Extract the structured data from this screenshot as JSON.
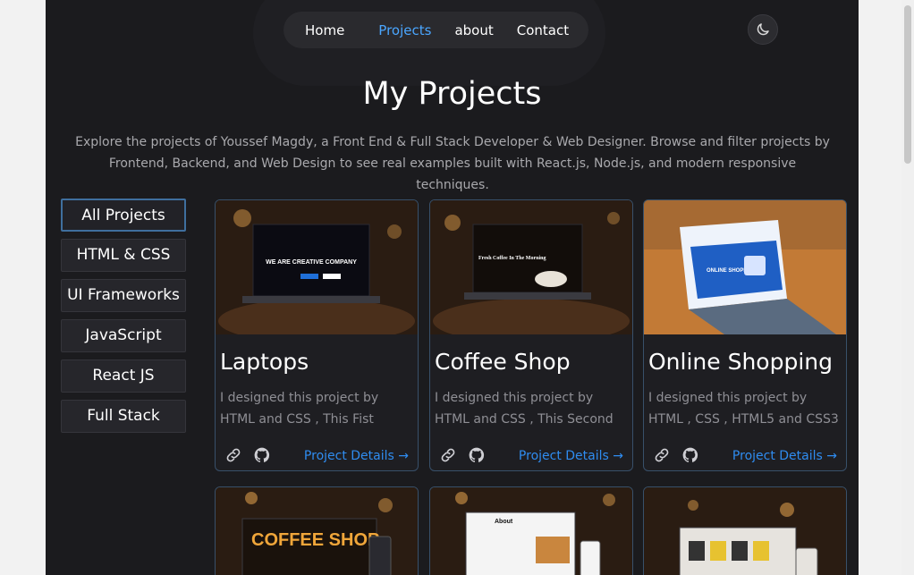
{
  "nav": {
    "items": [
      {
        "label": "Home"
      },
      {
        "label": "Projects"
      },
      {
        "label": "about"
      },
      {
        "label": "Contact"
      }
    ],
    "active_color": "#4aa6ff"
  },
  "theme_toggle": {
    "icon": "moon-icon"
  },
  "page": {
    "title": "My Projects",
    "intro": "Explore the projects of Youssef Magdy, a Front End & Full Stack Developer & Web Designer. Browse and filter projects by Frontend, Backend, and Web Design to see real examples built with React.js, Node.js, and modern responsive techniques."
  },
  "filters": [
    {
      "label": "All Projects"
    },
    {
      "label": "HTML & CSS"
    },
    {
      "label": "UI Frameworks"
    },
    {
      "label": "JavaScript"
    },
    {
      "label": "React JS"
    },
    {
      "label": "Full Stack"
    }
  ],
  "projects": [
    {
      "title": "Laptops",
      "description": "I designed this project by HTML and CSS , This Fist",
      "details_label": "Project Details →",
      "screen_heading": "WE ARE CREATIVE COMPANY"
    },
    {
      "title": "Coffee Shop",
      "description": "I designed this project by HTML and CSS , This Second",
      "details_label": "Project Details →",
      "screen_heading": "Fresh Coffee In The Morning"
    },
    {
      "title": "Online Shopping",
      "description": "I designed this project by HTML , CSS , HTML5 and CSS3",
      "details_label": "Project Details →",
      "screen_heading": "ONLINE SHOPPING"
    }
  ],
  "next_row": [
    {
      "screen_heading": "COFFEE SHOP"
    },
    {
      "screen_heading": "About"
    },
    {
      "screen_heading": ""
    }
  ],
  "colors": {
    "background": "#1b1b1e",
    "card_border": "#38506a",
    "link": "#2f8cf0"
  }
}
